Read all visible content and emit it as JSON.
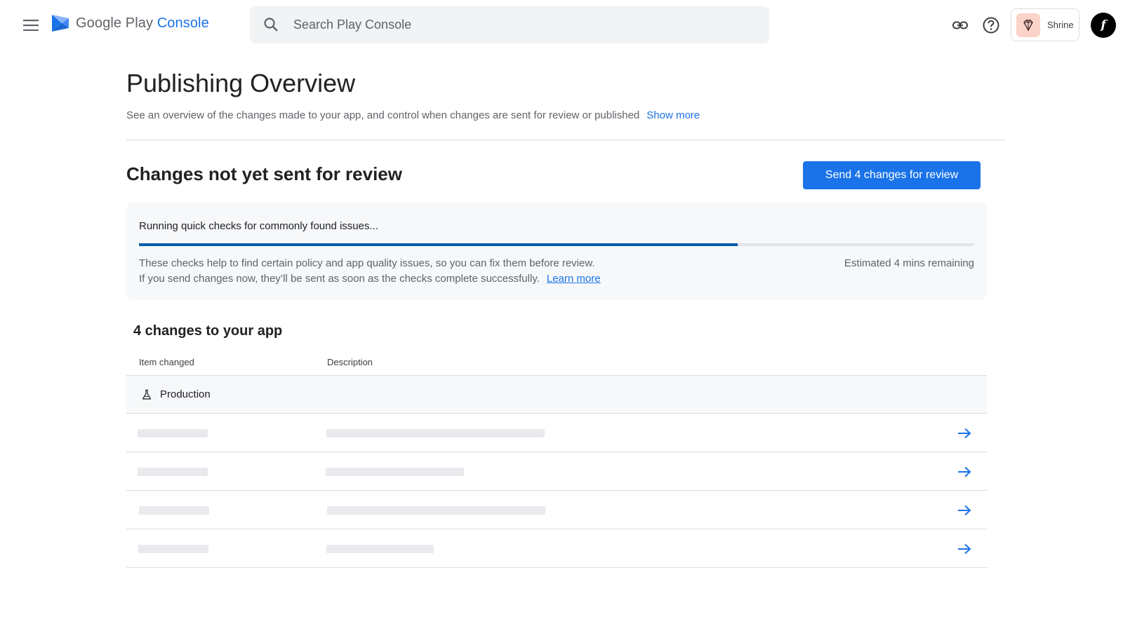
{
  "header": {
    "logo_text_main": "Google Play",
    "logo_text_accent": "Console",
    "search_placeholder": "Search Play Console",
    "app_chip_label": "Shrine",
    "avatar_letter": "f",
    "icons": [
      "menu-icon",
      "play-console-logo",
      "search-icon",
      "link-icon",
      "help-icon",
      "shrine-diamond-icon",
      "avatar"
    ]
  },
  "page": {
    "title": "Publishing Overview",
    "subtitle": "See an overview of the changes made to your app, and control when changes are sent for review or published",
    "show_more": "Show more"
  },
  "review": {
    "section_title": "Changes not yet sent for review",
    "send_button": "Send 4 changes for review",
    "check_title": "Running quick checks for commonly found issues...",
    "progress_fraction": 0.717,
    "desc_line1": "These checks help to find certain policy and app quality issues, so you can fix them before review.",
    "desc_line2": "If you send changes now, they’ll be sent as soon as the checks complete successfully.",
    "learn_more": "Learn more",
    "remaining": "Estimated 4 mins remaining"
  },
  "changes": {
    "title": "4 changes to your app",
    "columns": [
      "Item changed",
      "Description"
    ],
    "group_label": "Production",
    "rows": [
      {
        "loading": true
      },
      {
        "loading": true
      },
      {
        "loading": true
      },
      {
        "loading": true
      }
    ]
  },
  "colors": {
    "accent": "#1a73e8",
    "progress": "#0b5cad",
    "card_bg": "#f6f8fa",
    "skeleton": "#e8eaed",
    "app_icon_bg": "#fbd3c9"
  }
}
